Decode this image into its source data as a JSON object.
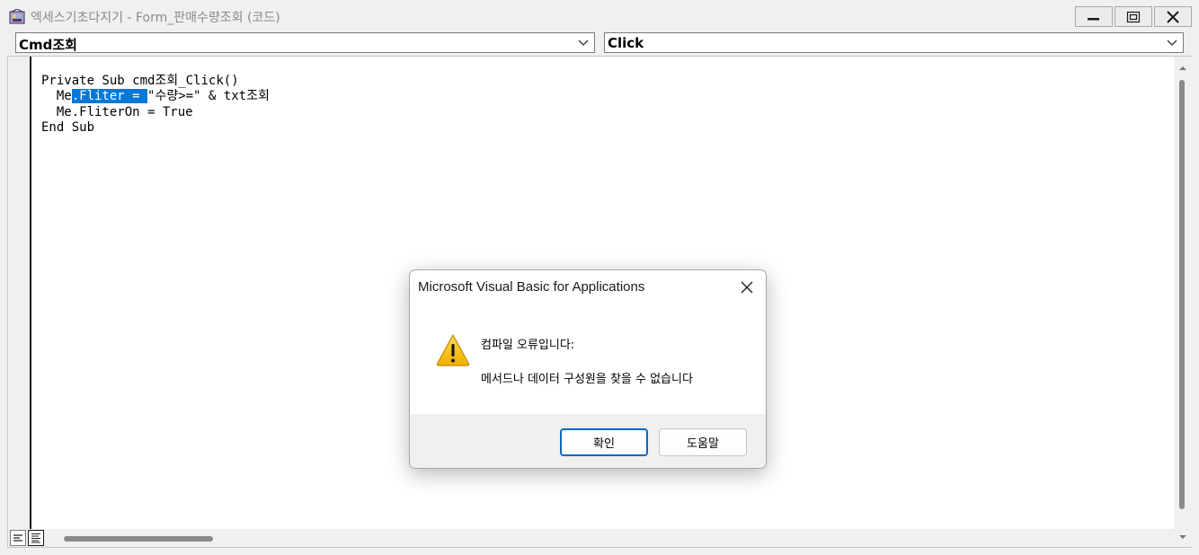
{
  "window": {
    "title": "엑세스기초다지기 - Form_판매수량조회 (코드)",
    "controls": [
      "minimize-icon",
      "maximize-icon",
      "close-icon"
    ]
  },
  "combos": {
    "object": "Cmd조회",
    "procedure": "Click"
  },
  "code": {
    "lines": [
      {
        "pre": "Private Sub cmd조회_Click()",
        "sel": "",
        "post": ""
      },
      {
        "pre": "  Me",
        "sel": ".Fliter = ",
        "post": "\"수량>=\" & txt조회"
      },
      {
        "pre": "  Me.FliterOn = True",
        "sel": "",
        "post": ""
      },
      {
        "pre": "End Sub",
        "sel": "",
        "post": ""
      }
    ]
  },
  "dialog": {
    "title": "Microsoft Visual Basic for Applications",
    "message_title": "컴파일 오류입니다:",
    "message_body": "메서드나 데이터 구성원을 찾을 수 없습니다",
    "ok_label": "확인",
    "help_label": "도움말",
    "icon": "warning-icon"
  },
  "colors": {
    "selection": "#0078d7",
    "accent": "#0067c0",
    "warning": "#f5c11a"
  }
}
